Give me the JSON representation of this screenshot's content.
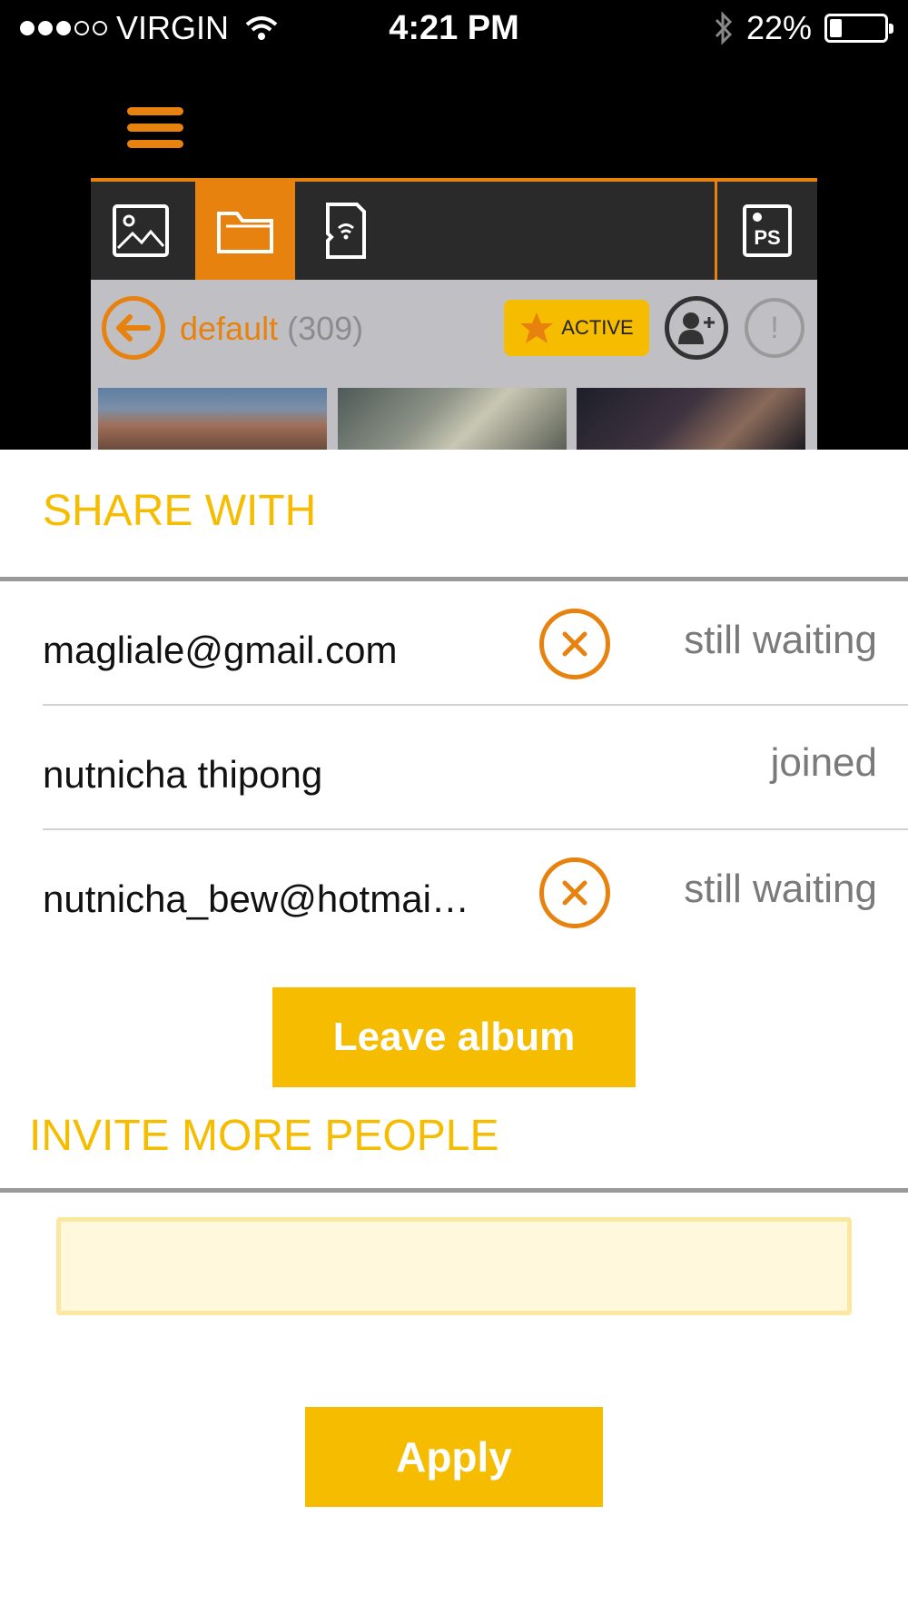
{
  "status_bar": {
    "carrier": "VIRGIN",
    "time": "4:21 PM",
    "battery": "22%",
    "battery_level": 0.22,
    "signal_bars": 3
  },
  "toolbar": {
    "icons": [
      "image-icon",
      "folder-icon",
      "sd-card-wifi-icon",
      "ps-icon"
    ],
    "active_index": 1
  },
  "album": {
    "name": "default",
    "count": "(309)",
    "badge": "ACTIVE"
  },
  "share": {
    "title": "SHARE WITH",
    "people": [
      {
        "name": "magliale@gmail.com",
        "status": "still waiting",
        "removable": true
      },
      {
        "name": "nutnicha thipong",
        "status": "joined",
        "removable": false
      },
      {
        "name": "nutnicha_bew@hotmai…",
        "status": "still waiting",
        "removable": true
      }
    ],
    "leave_label": "Leave album"
  },
  "invite": {
    "title": "INVITE MORE PEOPLE",
    "input_value": "",
    "apply_label": "Apply"
  },
  "colors": {
    "accent_orange": "#e8820f",
    "accent_yellow": "#f5bc00"
  }
}
